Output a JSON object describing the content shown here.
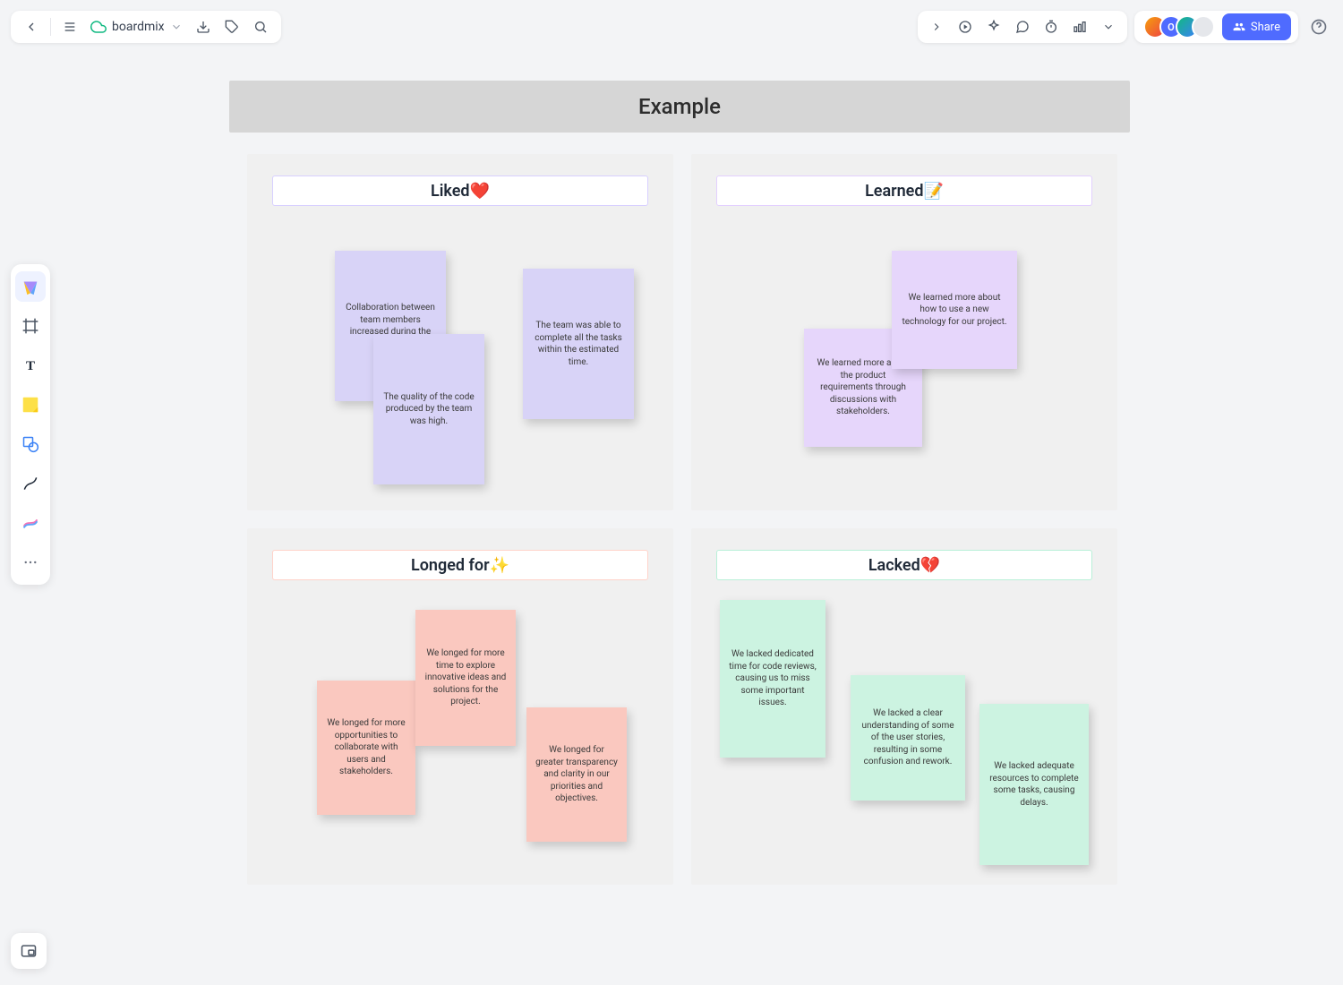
{
  "brand": "boardmix",
  "share_label": "Share",
  "board_title": "Example",
  "quadrants": {
    "liked": {
      "label": "Liked",
      "emoji": "❤️"
    },
    "learned": {
      "label": "Learned",
      "emoji": "📝"
    },
    "longed": {
      "label": "Longed for",
      "emoji": "✨"
    },
    "lacked": {
      "label": "Lacked",
      "emoji": "💔"
    }
  },
  "notes": {
    "liked": [
      "Collaboration between team members increased during the sprint.",
      "The quality of the code produced by the team was high.",
      "The team was able to complete all the tasks within the estimated time."
    ],
    "learned": [
      "We learned more about the product requirements through discussions with stakeholders.",
      "We learned more about how to use a new technology for our project."
    ],
    "longed": [
      "We longed for more opportunities to collaborate with users and stakeholders.",
      "We longed for more time to explore innovative ideas and solutions for the project.",
      "We longed for greater transparency and clarity in our priorities and objectives."
    ],
    "lacked": [
      "We lacked dedicated time for code reviews, causing us to miss some important issues.",
      "We lacked a clear understanding of some of the user stories, resulting in some confusion and rework.",
      "We lacked adequate resources to complete some tasks, causing delays."
    ]
  }
}
